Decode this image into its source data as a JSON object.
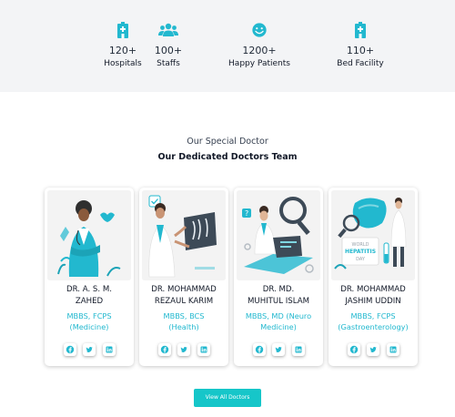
{
  "stats": [
    {
      "icon": "hospital-icon",
      "value": "120+",
      "label": "Hospitals"
    },
    {
      "icon": "users-icon",
      "value": "100+",
      "label": "Staffs"
    },
    {
      "icon": "smile-icon",
      "value": "1200+",
      "label": "Happy Patients"
    },
    {
      "icon": "bed-facility-icon",
      "value": "110+",
      "label": "Bed Facility"
    }
  ],
  "section": {
    "subtitle": "Our Special Doctor",
    "title": "Our Dedicated Doctors Team"
  },
  "doctors": [
    {
      "name_line1": "DR. A. S. M.",
      "name_line2": "ZAHED",
      "degree_line1": "MBBS, FCPS",
      "degree_line2": "(Medicine)",
      "illustration": "female-doctor-illustration"
    },
    {
      "name_line1": "DR. MOHAMMAD",
      "name_line2": "REZAUL KARIM",
      "degree_line1": "MBBS, BCS",
      "degree_line2": "(Health)",
      "illustration": "doctor-xray-illustration"
    },
    {
      "name_line1": "DR. MD.",
      "name_line2": "MUHITUL ISLAM",
      "degree_line1": "MBBS, MD (Neuro",
      "degree_line2": "Medicine)",
      "illustration": "doctor-research-illustration"
    },
    {
      "name_line1": "DR. MOHAMMAD",
      "name_line2": "JASHIM UDDIN",
      "degree_line1": "MBBS, FCPS",
      "degree_line2": "(Gastroenterology)",
      "illustration": "hepatitis-day-illustration",
      "poster_line1": "WORLD",
      "poster_line2": "HEPATITIS",
      "poster_line3": "DAY"
    }
  ],
  "social_icons": [
    "facebook-icon",
    "twitter-icon",
    "linkedin-icon"
  ],
  "cta": {
    "view_all_label": "View All Doctors"
  },
  "colors": {
    "accent": "#22b8cf",
    "button": "#16c6c9",
    "band": "#f3f4f6"
  }
}
